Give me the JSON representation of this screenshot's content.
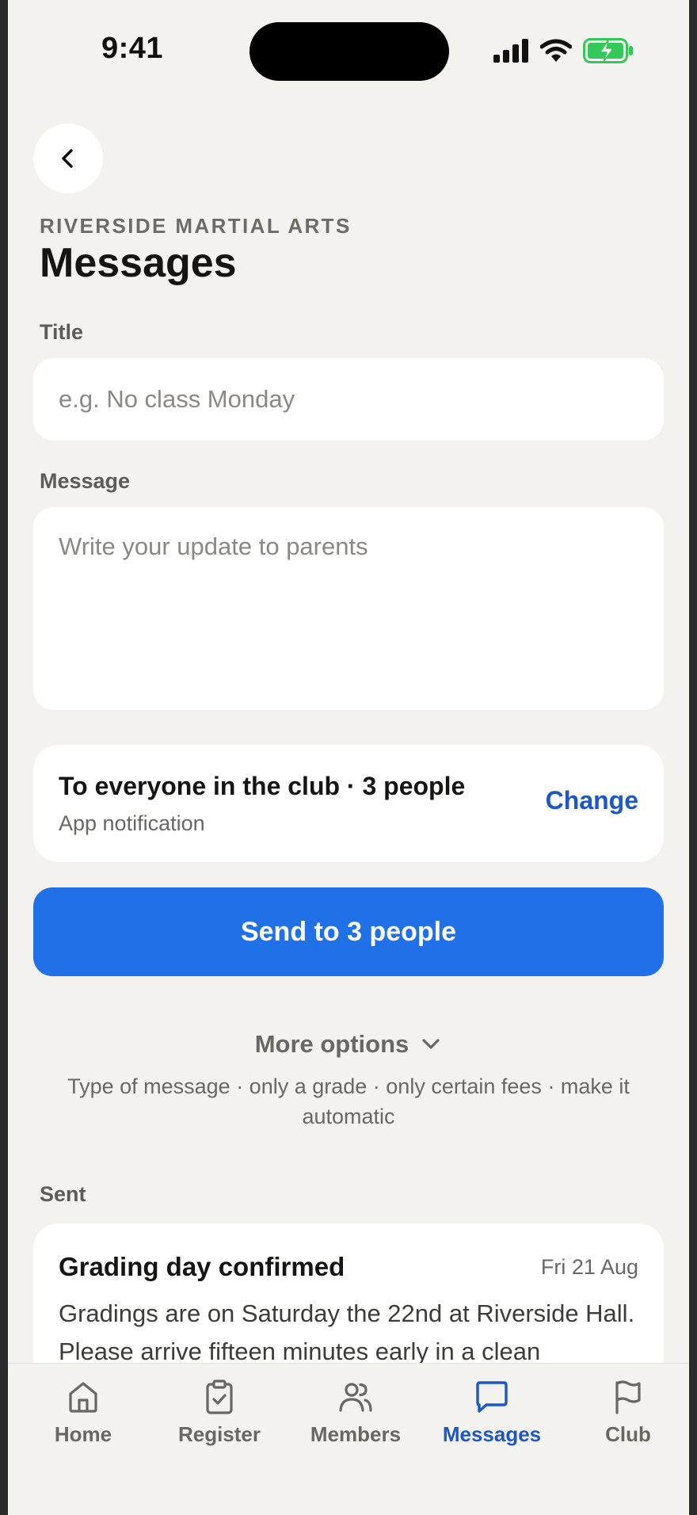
{
  "status": {
    "time": "9:41"
  },
  "header": {
    "club_name": "RIVERSIDE MARTIAL ARTS",
    "title": "Messages"
  },
  "form": {
    "title_label": "Title",
    "title_placeholder": "e.g. No class Monday",
    "title_value": "",
    "message_label": "Message",
    "message_placeholder": "Write your update to parents",
    "message_value": ""
  },
  "recipients": {
    "summary": "To everyone in the club · 3 people",
    "channel": "App notification",
    "change_label": "Change"
  },
  "send_button": "Send to 3 people",
  "more_options": {
    "label": "More options",
    "hint": "Type of message · only a grade · only certain fees · make it automatic"
  },
  "sent": {
    "label": "Sent",
    "items": [
      {
        "title": "Grading day confirmed",
        "date": "Fri 21 Aug",
        "body": "Gradings are on Saturday the 22nd at Riverside Hall. Please arrive fifteen minutes early in a clean"
      }
    ]
  },
  "tabbar": {
    "active": "Messages",
    "tabs": [
      {
        "label": "Home",
        "icon": "home-icon"
      },
      {
        "label": "Register",
        "icon": "clipboard-check-icon"
      },
      {
        "label": "Members",
        "icon": "users-icon"
      },
      {
        "label": "Messages",
        "icon": "message-icon"
      },
      {
        "label": "Club",
        "icon": "flag-icon"
      }
    ]
  },
  "colors": {
    "accent": "#2070e8",
    "link": "#1d57c4",
    "background": "#f3f2ef",
    "battery": "#34c759"
  }
}
